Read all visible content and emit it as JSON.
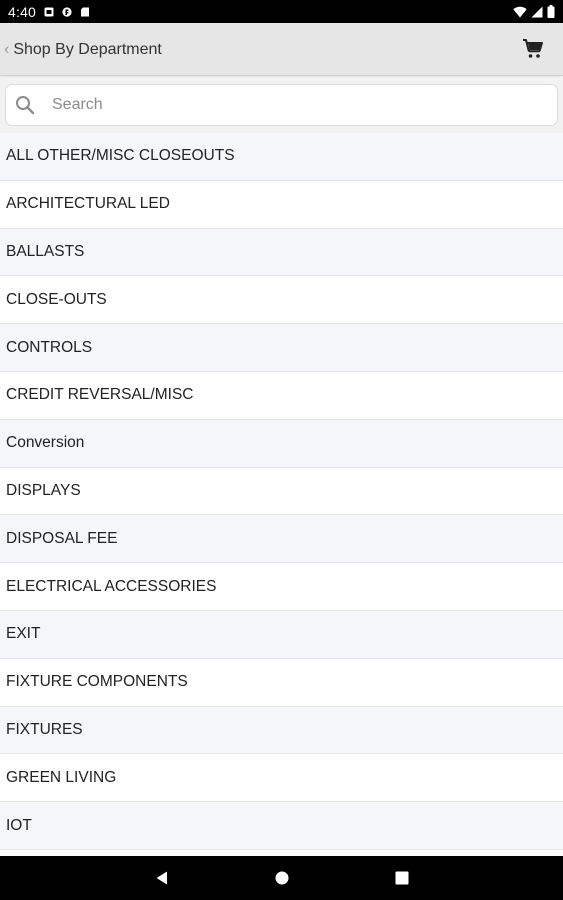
{
  "status_bar": {
    "time": "4:40",
    "left_icons": [
      "notification-icon",
      "app-notification-icon",
      "sd-card-icon"
    ],
    "right_icons": [
      "wifi-icon",
      "signal-icon",
      "battery-icon"
    ]
  },
  "app_bar": {
    "title": "Shop By Department",
    "back_icon": "chevron-left-icon",
    "cart_icon": "cart-icon"
  },
  "search": {
    "placeholder": "Search",
    "value": ""
  },
  "departments": [
    "ALL OTHER/MISC CLOSEOUTS",
    "ARCHITECTURAL LED",
    "BALLASTS",
    "CLOSE-OUTS",
    "CONTROLS",
    "CREDIT REVERSAL/MISC",
    "Conversion",
    "DISPLAYS",
    "DISPOSAL FEE",
    "ELECTRICAL ACCESSORIES",
    "EXIT",
    "FIXTURE COMPONENTS",
    "FIXTURES",
    "GREEN LIVING",
    "IOT"
  ],
  "nav_bar": {
    "icons": [
      "back-triangle-icon",
      "home-circle-icon",
      "recents-square-icon"
    ]
  },
  "colors": {
    "app_bar_bg": "#e6e6e6",
    "row_alt_bg": "#f5f6fa",
    "text": "#222222"
  }
}
